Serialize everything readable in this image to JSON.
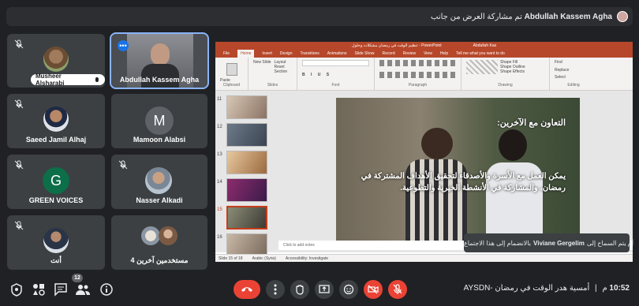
{
  "banner": {
    "text": "تم مشاركة العرض من جانب",
    "presenter": "Abdullah Kassem Agha"
  },
  "tiles": {
    "musheer": {
      "name": "Musheer Alsharabi"
    },
    "abdullah": {
      "name": "Abdullah Kassem Agha"
    },
    "saeed": {
      "name": "Saeed Jamil Alhaj"
    },
    "mamoon": {
      "name": "Mamoon Alabsi",
      "initial": "M"
    },
    "green": {
      "name": "GREEN VOICES",
      "initial": "G"
    },
    "nasser": {
      "name": "Nasser Alkadi"
    },
    "you": {
      "name": "أنت"
    },
    "others": {
      "name": "4 مستخدمين آخرين"
    }
  },
  "ppt": {
    "title": "تنظيم الوقت في رمضان مشكلات وحلول - PowerPoint",
    "user": "Abdullah Kas",
    "tabs": [
      "File",
      "Home",
      "Insert",
      "Design",
      "Transitions",
      "Animations",
      "Slide Show",
      "Record",
      "Review",
      "View",
      "Help",
      "Tell me what you want to do"
    ],
    "groups": [
      "Clipboard",
      "Slides",
      "Font",
      "Paragraph",
      "Drawing",
      "Editing"
    ],
    "ribbon_items": {
      "paste": "Paste",
      "new_slide": "New Slide",
      "layout": "Layout",
      "reset": "Reset",
      "section": "Section",
      "find": "Find",
      "replace": "Replace",
      "select": "Select",
      "shape_fill": "Shape Fill",
      "shape_outline": "Shape Outline",
      "shape_effects": "Shape Effects"
    },
    "slide_numbers": [
      "11",
      "12",
      "13",
      "14",
      "15",
      "16"
    ],
    "slide_title": "التعاون مع الآخرين:",
    "slide_body": "يمكن العمل مع الأسرة والأصدقاء لتحقيق الأهداف المشتركة في رمضان، والمشاركة في الأنشطة الخيرية والتطوعية.",
    "notes": "Click to add notes",
    "status": {
      "slide": "Slide 15 of 18",
      "lang": "Arabic (Syria)",
      "accessibility": "Accessibility: Investigate"
    }
  },
  "toast": {
    "prefix": "أم يتم السماح إلى",
    "name": "Viviane Gergelim",
    "suffix": "بالانضمام إلى هذا الاجتماع"
  },
  "controls": {
    "participants_count": "12"
  },
  "meeting": {
    "time": "10:52",
    "ampm": "م",
    "name": "أمسية هدر الوقت في رمضان -AYSDN"
  },
  "colors": {
    "bg": "#202124",
    "tile": "#3c4043",
    "red": "#ea4335",
    "ppt": "#b7472a",
    "active": "#8ab4f8"
  }
}
